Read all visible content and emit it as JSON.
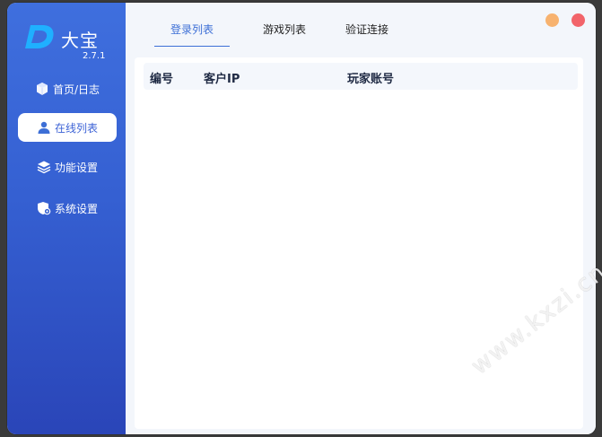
{
  "app": {
    "name": "大宝",
    "version": "2.7.1"
  },
  "sidebar": {
    "items": [
      {
        "label": "首页/日志",
        "icon": "cube-icon",
        "active": false
      },
      {
        "label": "在线列表",
        "icon": "user-icon",
        "active": true
      },
      {
        "label": "功能设置",
        "icon": "layers-icon",
        "active": false
      },
      {
        "label": "系统设置",
        "icon": "shield-gear-icon",
        "active": false
      }
    ]
  },
  "tabs": [
    {
      "label": "登录列表",
      "active": true
    },
    {
      "label": "游戏列表",
      "active": false
    },
    {
      "label": "验证连接",
      "active": false
    }
  ],
  "window_controls": {
    "minimize_color": "#f7b26f",
    "close_color": "#f2646a"
  },
  "table": {
    "columns": [
      "编号",
      "客户IP",
      "玩家账号"
    ],
    "rows": []
  },
  "watermark": "www.kxzi.cn",
  "colors": {
    "sidebar_top": "#3f6fde",
    "sidebar_bottom": "#2a45b8",
    "accent": "#3d6fd6"
  }
}
